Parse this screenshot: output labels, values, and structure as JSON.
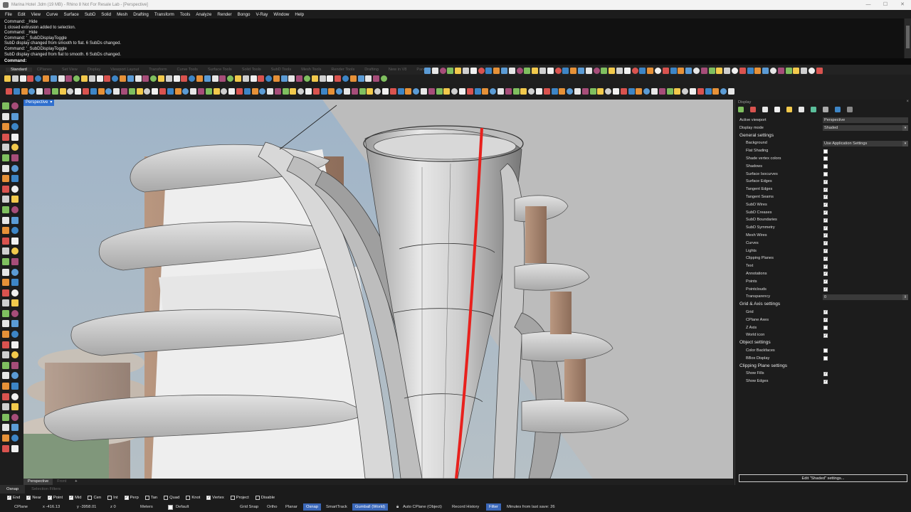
{
  "window": {
    "title": "Marina Hotel .3dm (19 MB) - Rhino 8 Not For Resale Lab - [Perspective]"
  },
  "menu": [
    "File",
    "Edit",
    "View",
    "Curve",
    "Surface",
    "SubD",
    "Solid",
    "Mesh",
    "Drafting",
    "Transform",
    "Tools",
    "Analyze",
    "Render",
    "Bongo",
    "V-Ray",
    "Window",
    "Help"
  ],
  "command_history": [
    "Command: _Hide",
    "1 closed extrusion added to selection.",
    "Command: _Hide",
    "Command: '_SubDDisplayToggle",
    "SubD display changed from smooth to flat. 6 SubDs changed.",
    "Command: '_SubDDisplayToggle",
    "SubD display changed from flat to smooth. 6 SubDs changed."
  ],
  "command_prompt": "Command:",
  "toolbar_tabs": [
    "Standard",
    "CPlanes",
    "Set View",
    "Display",
    "Viewport Layout",
    "Transform",
    "Curve Tools",
    "Surface Tools",
    "Solid Tools",
    "SubD Tools",
    "Mesh Tools",
    "Render Tools",
    "Drafting",
    "New in V8",
    "PanelRh"
  ],
  "viewport": {
    "label": "Perspective",
    "menu_glyph": "▾",
    "tabs": [
      "Perspective",
      "Front"
    ],
    "add_glyph": "+"
  },
  "display_panel": {
    "title": "Display",
    "close_glyph": "×",
    "rows": [
      {
        "type": "top",
        "label": "Active viewport",
        "value": "Perspective"
      },
      {
        "type": "top",
        "label": "Display mode",
        "value": "Shaded",
        "dropdown": true
      },
      {
        "type": "header",
        "label": "General settings"
      },
      {
        "type": "field",
        "label": "Background",
        "value": "Use Application Settings",
        "dropdown": true
      },
      {
        "type": "check",
        "label": "Flat Shading",
        "checked": false
      },
      {
        "type": "check",
        "label": "Shade vertex colors",
        "checked": false
      },
      {
        "type": "check",
        "label": "Shadows",
        "checked": false
      },
      {
        "type": "check",
        "label": "Surface Isocurves",
        "checked": false
      },
      {
        "type": "check",
        "label": "Surface Edges",
        "checked": true
      },
      {
        "type": "check",
        "label": "Tangent Edges",
        "checked": true
      },
      {
        "type": "check",
        "label": "Tangent Seams",
        "checked": true
      },
      {
        "type": "check",
        "label": "SubD Wires",
        "checked": true
      },
      {
        "type": "check",
        "label": "SubD Creases",
        "checked": true
      },
      {
        "type": "check",
        "label": "SubD Boundaries",
        "checked": true
      },
      {
        "type": "check",
        "label": "SubD Symmetry",
        "checked": true
      },
      {
        "type": "check",
        "label": "Mesh Wires",
        "checked": true
      },
      {
        "type": "check",
        "label": "Curves",
        "checked": true
      },
      {
        "type": "check",
        "label": "Lights",
        "checked": true
      },
      {
        "type": "check",
        "label": "Clipping Planes",
        "checked": true
      },
      {
        "type": "check",
        "label": "Text",
        "checked": true
      },
      {
        "type": "check",
        "label": "Annotations",
        "checked": true
      },
      {
        "type": "check",
        "label": "Points",
        "checked": true
      },
      {
        "type": "check",
        "label": "Pointclouds",
        "checked": true
      },
      {
        "type": "field",
        "label": "Transparency",
        "value": "0",
        "spinner": true
      },
      {
        "type": "header",
        "label": "Grid & Axis settings"
      },
      {
        "type": "check",
        "label": "Grid",
        "checked": true
      },
      {
        "type": "check",
        "label": "CPlane Axes",
        "checked": true
      },
      {
        "type": "check",
        "label": "Z Axis",
        "checked": false
      },
      {
        "type": "check",
        "label": "World icon",
        "checked": true
      },
      {
        "type": "header",
        "label": "Object settings"
      },
      {
        "type": "check",
        "label": "Color Backfaces",
        "checked": false
      },
      {
        "type": "check",
        "label": "BBox Display",
        "checked": false
      },
      {
        "type": "header",
        "label": "Clipping Plane settings"
      },
      {
        "type": "check",
        "label": "Show Fills",
        "checked": true
      },
      {
        "type": "check",
        "label": "Show Edges",
        "checked": true
      }
    ],
    "edit_button": "Edit \"Shaded\" settings..."
  },
  "osnap": {
    "tabs": [
      "Osnap",
      "Selection Filters"
    ],
    "items": [
      {
        "label": "End",
        "checked": true
      },
      {
        "label": "Near",
        "checked": true
      },
      {
        "label": "Point",
        "checked": true
      },
      {
        "label": "Mid",
        "checked": true
      },
      {
        "label": "Cen",
        "checked": false
      },
      {
        "label": "Int",
        "checked": false
      },
      {
        "label": "Perp",
        "checked": true
      },
      {
        "label": "Tan",
        "checked": false
      },
      {
        "label": "Quad",
        "checked": false
      },
      {
        "label": "Knot",
        "checked": false
      },
      {
        "label": "Vertex",
        "checked": true
      },
      {
        "label": "Project",
        "checked": false
      },
      {
        "label": "Disable",
        "checked": false
      }
    ]
  },
  "status": {
    "cplane": "CPlane",
    "x": "x -416.13",
    "y": "y -3958.01",
    "z": "z 0",
    "units": "Meters",
    "layer": "Default",
    "grid_snap": "Grid Snap",
    "ortho": "Ortho",
    "planar": "Planar",
    "osnap": "Osnap",
    "smarttrack": "SmartTrack",
    "gumball": "Gumball (World)",
    "autocplane": "Auto CPlane (Object)",
    "record_history": "Record History",
    "filter": "Filter",
    "last_save": "Minutes from last save: 26"
  },
  "colors": {
    "accent": "#2f6fce",
    "highlight_edge": "#e8211d"
  }
}
